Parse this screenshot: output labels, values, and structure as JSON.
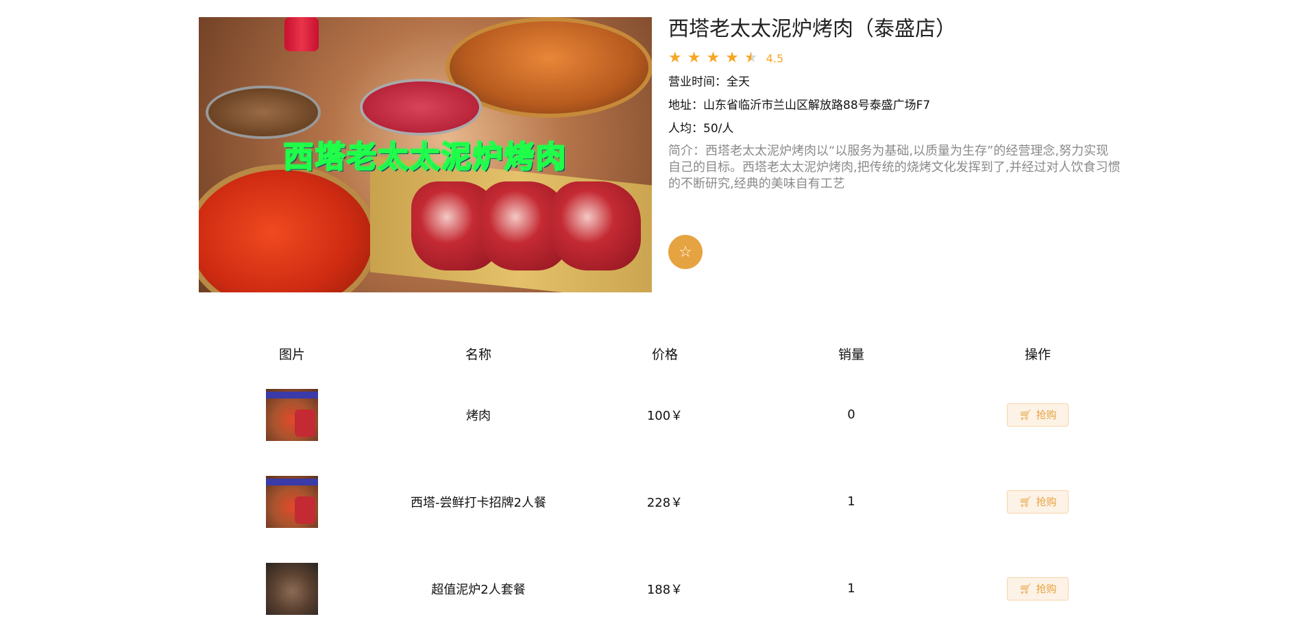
{
  "shop": {
    "banner_text": "西塔老太太泥炉烤肉",
    "name": "西塔老太太泥炉烤肉（泰盛店）",
    "rating": 4.5,
    "rating_text": "4.5",
    "hours_line": "营业时间：全天",
    "address_line": "地址：山东省临沂市兰山区解放路88号泰盛广场F7",
    "avg_price_line": "人均：50/人",
    "intro": "简介：西塔老太太泥炉烤肉以“以服务为基础,以质量为生存”的经营理念,努力实现自己的目标。西塔老太太泥炉烤肉,把传统的烧烤文化发挥到了,并经过对人饮食习惯的不断研究,经典的美味自有工艺",
    "favorite_icon": "star-outline-icon",
    "accent_color": "#e6a341"
  },
  "table": {
    "headers": [
      "图片",
      "名称",
      "价格",
      "销量",
      "操作"
    ],
    "rows": [
      {
        "name": "烤肉",
        "price": "100￥",
        "sales": "0",
        "action": "抢购"
      },
      {
        "name": "西塔-尝鲜打卡招牌2人餐",
        "price": "228￥",
        "sales": "1",
        "action": "抢购"
      },
      {
        "name": "超值泥炉2人套餐",
        "price": "188￥",
        "sales": "1",
        "action": "抢购"
      }
    ]
  }
}
